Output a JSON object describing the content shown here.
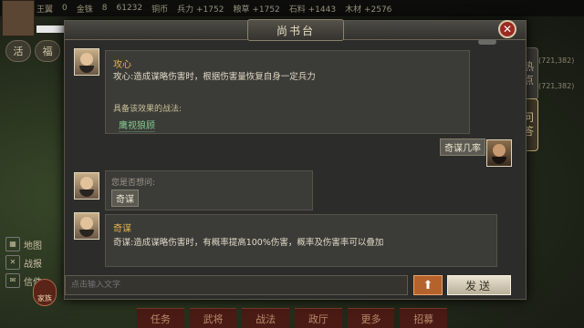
{
  "window": {
    "title": "尚书台"
  },
  "top_bar": {
    "items": [
      "王翼",
      "0",
      "金铢",
      "8",
      "61232",
      "铜币",
      "兵力 +1752",
      "粮草 +1752",
      "石料 +1443",
      "木材 +2576"
    ]
  },
  "left_icons": [
    "活",
    "福"
  ],
  "left_menu": [
    {
      "label": "地图",
      "icon": "map-icon"
    },
    {
      "label": "战报",
      "icon": "battle-report-icon"
    },
    {
      "label": "信件",
      "icon": "mail-icon"
    }
  ],
  "home_badge": "家族",
  "bottom_tabs": [
    "任务",
    "武将",
    "战法",
    "政厅",
    "更多",
    "招募"
  ],
  "right_list": [
    "(721,382)",
    "(721,382)"
  ],
  "side_tabs": [
    {
      "label": "热点",
      "chars": [
        "热",
        "点"
      ],
      "active": false
    },
    {
      "label": "问答",
      "chars": [
        "问",
        "答"
      ],
      "active": true
    }
  ],
  "messages": {
    "answer1": {
      "title": "攻心",
      "text": "攻心:造成谋略伤害时，根据伤害量恢复自身一定兵力",
      "related_label": "具备该效果的战法:",
      "link": "鹰视狼顾"
    },
    "user_question": {
      "text": "奇谋几率"
    },
    "answer2": {
      "hint": "您是否想问:",
      "suggestion": "奇谋"
    },
    "answer3": {
      "title": "奇谋",
      "text": "奇谋:造成谋略伤害时，有概率提高100%伤害，概率及伤害率可以叠加"
    }
  },
  "input": {
    "placeholder": "点击输入文字",
    "value": ""
  },
  "buttons": {
    "send": "发送",
    "up_arrow": "⬆",
    "close": "✕"
  },
  "colors": {
    "accent_gold": "#e2b24a",
    "link_green": "#84c98e",
    "close_red": "#9a2a22",
    "up_orange": "#b5622c"
  }
}
